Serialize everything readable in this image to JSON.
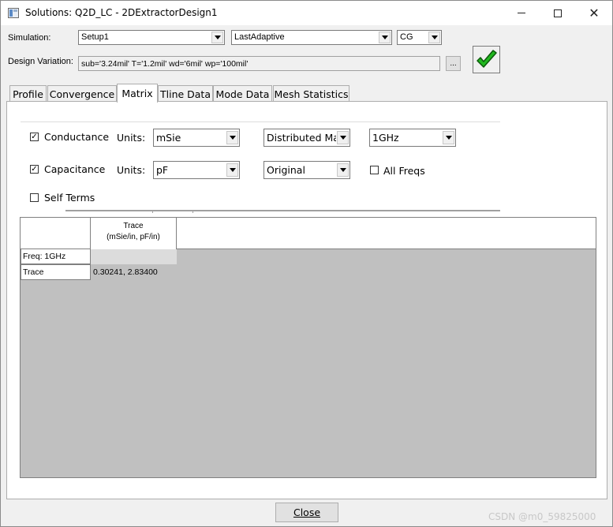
{
  "window": {
    "title": "Solutions: Q2D_LC - 2DExtractorDesign1",
    "minimize_icon": "minimize-icon",
    "maximize_icon": "maximize-icon",
    "close_icon": "close-icon",
    "close_glyph": "✕"
  },
  "simulation": {
    "label": "Simulation:",
    "setup": "Setup1",
    "pass": "LastAdaptive",
    "type": "CG"
  },
  "design_variation": {
    "label": "Design Variation:",
    "value": "sub='3.24mil' T='1.2mil' wd='6mil' wp='100mil'",
    "browse_label": "...",
    "apply_icon": "green-checkmark-icon"
  },
  "tabs": [
    {
      "label": "Profile"
    },
    {
      "label": "Convergence"
    },
    {
      "label": "Matrix"
    },
    {
      "label": "Tline Data"
    },
    {
      "label": "Mode Data"
    },
    {
      "label": "Mesh Statistics"
    }
  ],
  "active_tab": "Matrix",
  "matrix": {
    "conductance": {
      "label": "Conductance",
      "checked": true,
      "units_label": "Units:",
      "units": "mSie",
      "mode": "Distributed Ma",
      "freq": "1GHz"
    },
    "capacitance": {
      "label": "Capacitance",
      "checked": true,
      "units_label": "Units:",
      "units": "pF",
      "mode": "Original"
    },
    "all_freqs": {
      "label": "All Freqs",
      "checked": false
    },
    "self_terms": {
      "label": "Self Terms",
      "checked": false
    },
    "check_mark": "✓"
  },
  "grid": {
    "column_header_line1": "Trace",
    "column_header_line2": "(mSie/in, pF/in)",
    "rows": [
      {
        "label": "Freq: 1GHz",
        "value": ""
      },
      {
        "label": "Trace",
        "value": "0.30241, 2.83400"
      }
    ]
  },
  "footer": {
    "close_label": "Close"
  },
  "watermark": "CSDN @m0_59825000",
  "colors": {
    "accent_check": "#21b81f",
    "grid_bg": "#c0c0c0"
  }
}
